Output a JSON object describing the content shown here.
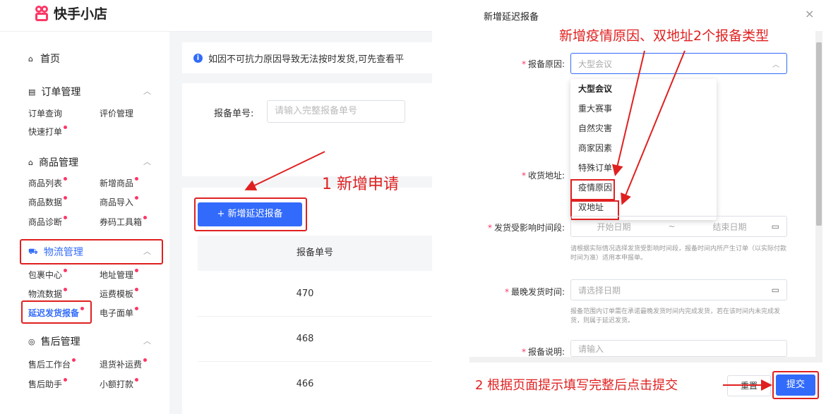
{
  "brand": {
    "name": "快手小店"
  },
  "sidebar": {
    "home": "首页",
    "sections": [
      {
        "title": "订单管理",
        "items": [
          {
            "label": "订单查询",
            "dot": false
          },
          {
            "label": "评价管理",
            "dot": false
          },
          {
            "label": "快速打单",
            "dot": true
          }
        ]
      },
      {
        "title": "商品管理",
        "items": [
          {
            "label": "商品列表",
            "dot": true
          },
          {
            "label": "新增商品",
            "dot": true
          },
          {
            "label": "商品数据",
            "dot": true
          },
          {
            "label": "商品导入",
            "dot": true
          },
          {
            "label": "商品诊断",
            "dot": true
          },
          {
            "label": "券码工具箱",
            "dot": true
          }
        ]
      },
      {
        "title": "物流管理",
        "items": [
          {
            "label": "包裹中心",
            "dot": true
          },
          {
            "label": "地址管理",
            "dot": true
          },
          {
            "label": "物流数据",
            "dot": true
          },
          {
            "label": "运费模板",
            "dot": true
          },
          {
            "label": "延迟发货报备",
            "dot": true
          },
          {
            "label": "电子面单",
            "dot": true
          }
        ]
      },
      {
        "title": "售后管理",
        "items": [
          {
            "label": "售后工作台",
            "dot": true
          },
          {
            "label": "退货补运费",
            "dot": true
          },
          {
            "label": "售后助手",
            "dot": true
          },
          {
            "label": "小额打款",
            "dot": true
          }
        ]
      }
    ]
  },
  "main": {
    "notice": "如因不可抗力原因导致无法按时发货,可先查看平",
    "search_label": "报备单号:",
    "search_placeholder": "请输入完整报备单号",
    "add_button": "+ 新增延迟报备",
    "table_header": "报备单号",
    "rows": [
      "470",
      "468",
      "466"
    ]
  },
  "dialog": {
    "title": "新增延迟报备",
    "close": "×",
    "reason_label": "报备原因:",
    "reason_placeholder": "大型会议",
    "reason_options": [
      "大型会议",
      "重大赛事",
      "自然灾害",
      "商家因素",
      "特殊订单",
      "疫情原因",
      "双地址"
    ],
    "address_label": "收货地址:",
    "period_label": "发货受影响时间段:",
    "period_start": "开始日期",
    "period_sep": "~",
    "period_end": "结束日期",
    "period_hint": "请根据实际情况选择发货受影响时间段，报备时间内所产生订单（以实际付款时间为准）适用本申报单。",
    "latest_label": "最晚发货时间:",
    "latest_placeholder": "请选择日期",
    "latest_hint": "报备范围内订单需在承诺最晚发货时间内完成发货，若在该时间内未完成发货，则属于延迟发货。",
    "remark_label": "报备说明:",
    "remark_placeholder": "请输入",
    "reset": "重置",
    "submit": "提交"
  },
  "annotations": {
    "step1": "1 新增申请",
    "step2": "2 根据页面提示填写完整后点击提交",
    "types": "新增疫情原因、双地址2个报备类型"
  },
  "colors": {
    "accent": "#326bfb",
    "brand": "#fe3666",
    "annotation": "#e02020"
  }
}
